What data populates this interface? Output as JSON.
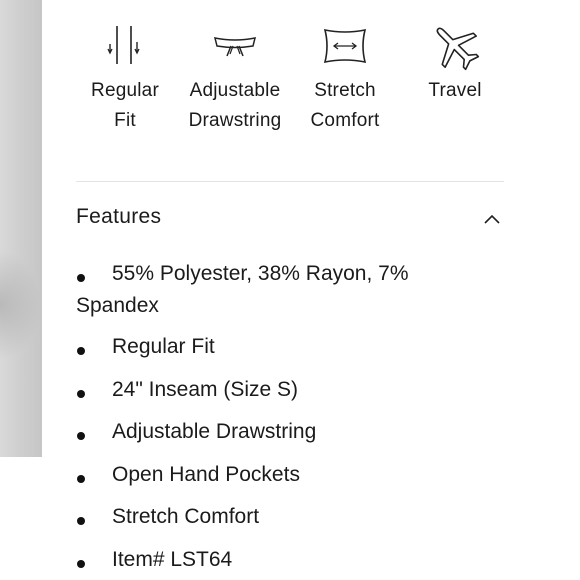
{
  "icons": [
    {
      "icon": "regular-fit-icon",
      "label": "Regular\nFit"
    },
    {
      "icon": "drawstring-icon",
      "label": "Adjustable\nDrawstring"
    },
    {
      "icon": "stretch-icon",
      "label": "Stretch\nComfort"
    },
    {
      "icon": "airplane-icon",
      "label": "Travel"
    }
  ],
  "features": {
    "title": "Features",
    "items": [
      "55% Polyester, 38% Rayon, 7% Spandex",
      "Regular Fit",
      "24\" Inseam (Size S)",
      "Adjustable Drawstring",
      "Open Hand Pockets",
      "Stretch Comfort",
      "Item# LST64"
    ]
  }
}
